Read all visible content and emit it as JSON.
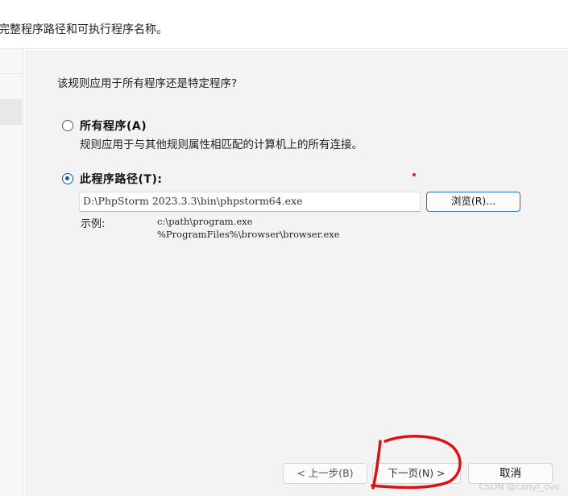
{
  "header": {
    "description": "完整程序路径和可执行程序名称。"
  },
  "question": "该规则应用于所有程序还是特定程序?",
  "options": [
    {
      "label": "所有程序(A)",
      "description": "规则应用于与其他规则属性相匹配的计算机上的所有连接。",
      "selected": false
    },
    {
      "label": "此程序路径(T):",
      "selected": true
    }
  ],
  "program_path": {
    "value": "D:\\PhpStorm 2023.3.3\\bin\\phpstorm64.exe",
    "browse_label": "浏览(R)..."
  },
  "example": {
    "label": "示例:",
    "lines": [
      "c:\\path\\program.exe",
      "%ProgramFiles%\\browser\\browser.exe"
    ]
  },
  "buttons": {
    "back": "< 上一步(B)",
    "next": "下一页(N) >",
    "cancel": "取消"
  },
  "colors": {
    "accent": "#005fb8",
    "annotation": "#e01010"
  },
  "watermark": "CSDN @canyi_ovo"
}
